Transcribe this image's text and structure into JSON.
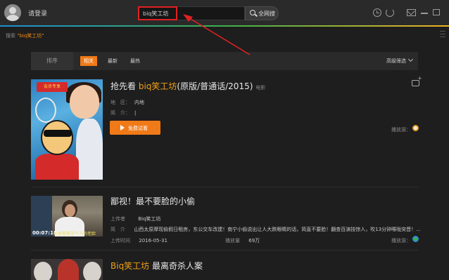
{
  "topbar": {
    "login_label": "请登录",
    "search_value": "biq笑工坊",
    "search_button": "全网搜"
  },
  "crumb": {
    "prefix": "搜索",
    "query": "\"biq笑工坊\""
  },
  "filter": {
    "sort_label": "排序",
    "tabs": [
      {
        "label": "相关",
        "active": true
      },
      {
        "label": "最新",
        "active": false
      },
      {
        "label": "最热",
        "active": false
      }
    ],
    "advanced": "高级筛选"
  },
  "result1": {
    "title_prefix": "抢先看 ",
    "title_highlight": "biq笑工坊",
    "title_suffix": "(原版/普通话/2015)",
    "type": "电影",
    "badge": "会员专享",
    "region_label": "地　区：",
    "region_value": "内地",
    "intro_label": "简　介：",
    "intro_value": "|",
    "play_button": "免费试看",
    "source_label": "播放源："
  },
  "result2": {
    "title": "鄙视！最不要脸的小偷",
    "uploader_label": "上传者",
    "uploader_value": "Biq笑工坊",
    "intro_label": "简　介",
    "intro_value": "山西太原摩现偷假日租房，东公交车改建！南宁小偷说出让人大跌眼睛的话，简直不要脸！翻查百演技惊人，吹13分钟喉咙突晋！...",
    "upload_time_label": "上传时间",
    "upload_time_value": "2016-05-31",
    "plays_label": "播放量",
    "plays_value": "69万",
    "source_label": "播放源：",
    "duration": "00:07:18",
    "caption": "大家看看这个人的老脸"
  },
  "result3": {
    "title_highlight": "Biq笑工坊",
    "title_suffix": " 最离奇杀人案"
  }
}
